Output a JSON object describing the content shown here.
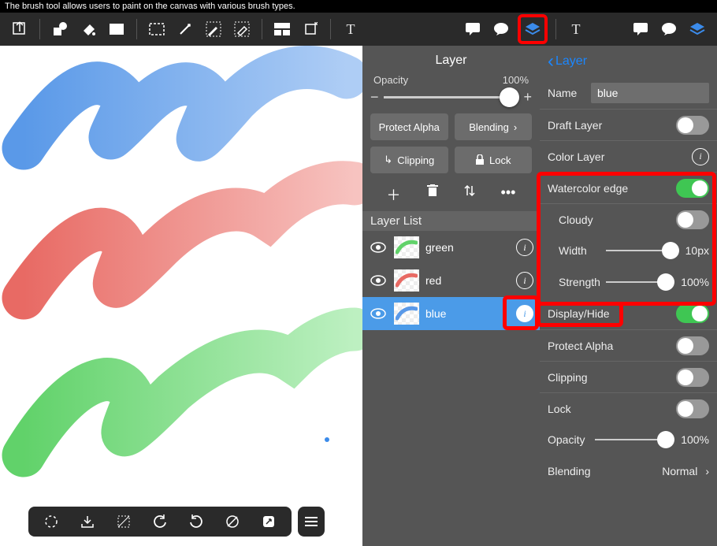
{
  "tooltip": "The brush tool allows users to paint on the canvas with various brush types.",
  "toolbar_icons": [
    "export",
    "shape",
    "fill",
    "rect",
    "marquee",
    "wand",
    "pen",
    "eraser",
    "layout",
    "transform",
    "text",
    "comment",
    "chat",
    "layers",
    "text2",
    "comment2",
    "chat2",
    "layers2"
  ],
  "layer_panel": {
    "title": "Layer",
    "opacity_label": "Opacity",
    "opacity_value": "100%",
    "protect_alpha": "Protect Alpha",
    "blending": "Blending",
    "clipping": "Clipping",
    "lock": "Lock",
    "list_header": "Layer List",
    "items": [
      {
        "name": "green",
        "color": "#61d26a"
      },
      {
        "name": "red",
        "color": "#e86a64"
      },
      {
        "name": "blue",
        "color": "#5a99e8"
      }
    ]
  },
  "details": {
    "back": "Layer",
    "name_label": "Name",
    "name_value": "blue",
    "rows": {
      "draft": "Draft Layer",
      "color": "Color Layer",
      "wce": "Watercolor edge",
      "cloudy": "Cloudy",
      "width_label": "Width",
      "width_value": "10px",
      "strength_label": "Strength",
      "strength_value": "100%",
      "display": "Display/Hide",
      "protect": "Protect Alpha",
      "clipping": "Clipping",
      "lock": "Lock",
      "opacity_label": "Opacity",
      "opacity_value": "100%",
      "blending_label": "Blending",
      "blending_value": "Normal"
    }
  }
}
